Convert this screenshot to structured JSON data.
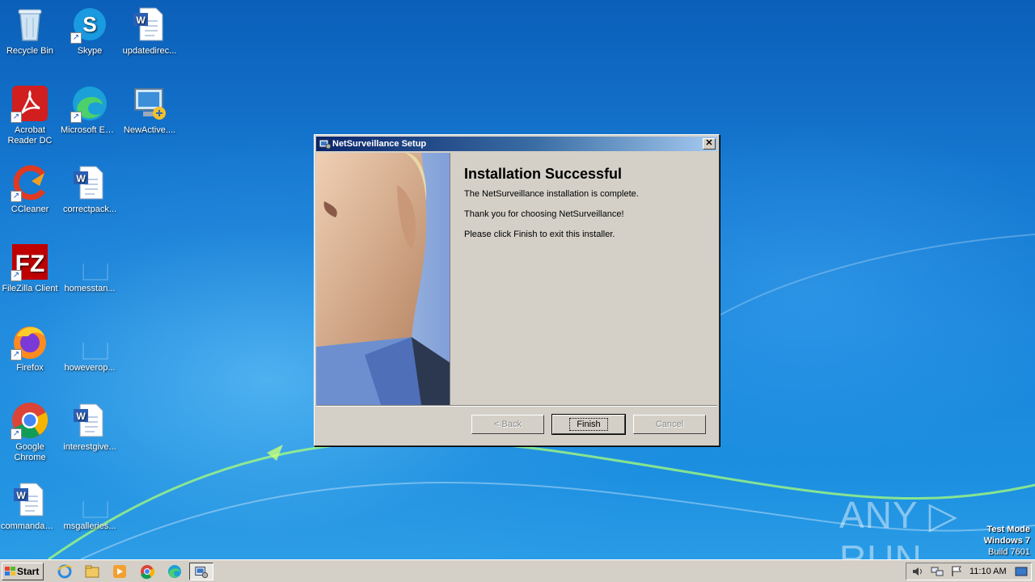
{
  "desktop": {
    "icons": [
      {
        "label": "Recycle Bin",
        "glyph": "recycle-bin-icon"
      },
      {
        "label": "Skype",
        "glyph": "skype-icon"
      },
      {
        "label": "updatedirec...",
        "glyph": "word-document-icon"
      },
      {
        "label": "Acrobat Reader DC",
        "glyph": "acrobat-icon"
      },
      {
        "label": "Microsoft Edge",
        "glyph": "edge-icon"
      },
      {
        "label": "NewActive....",
        "glyph": "computer-icon"
      },
      {
        "label": "CCleaner",
        "glyph": "ccleaner-icon"
      },
      {
        "label": "correctpack...",
        "glyph": "word-document-icon"
      },
      {
        "label": "FileZilla Client",
        "glyph": "filezilla-icon"
      },
      {
        "label": "homesstan...",
        "glyph": "blank-file-icon"
      },
      {
        "label": "Firefox",
        "glyph": "firefox-icon"
      },
      {
        "label": "howeverop...",
        "glyph": "blank-file-icon"
      },
      {
        "label": "Google Chrome",
        "glyph": "chrome-icon"
      },
      {
        "label": "interestgive...",
        "glyph": "word-document-icon"
      },
      {
        "label": "commandam...",
        "glyph": "word-document-icon"
      },
      {
        "label": "msgalleries...",
        "glyph": "blank-file-icon"
      }
    ]
  },
  "dialog": {
    "title": "NetSurveillance Setup",
    "close_label": "✕",
    "heading": "Installation Successful",
    "line1": "The NetSurveillance  installation is complete.",
    "line2": "Thank you for choosing NetSurveillance!",
    "line3": "Please click Finish to exit this installer.",
    "back_label": "< Back",
    "finish_label": "Finish",
    "cancel_label": "Cancel"
  },
  "watermark": {
    "text": "ANY ▷ RUN"
  },
  "os_info": {
    "line1": "Test Mode",
    "line2": "Windows 7",
    "line3": "Build 7601"
  },
  "taskbar": {
    "start_label": "Start",
    "clock": "11:10 AM"
  },
  "colors": {
    "title_active": "#0a246a",
    "face": "#d4d0c8",
    "desktop": "#1577d0"
  }
}
